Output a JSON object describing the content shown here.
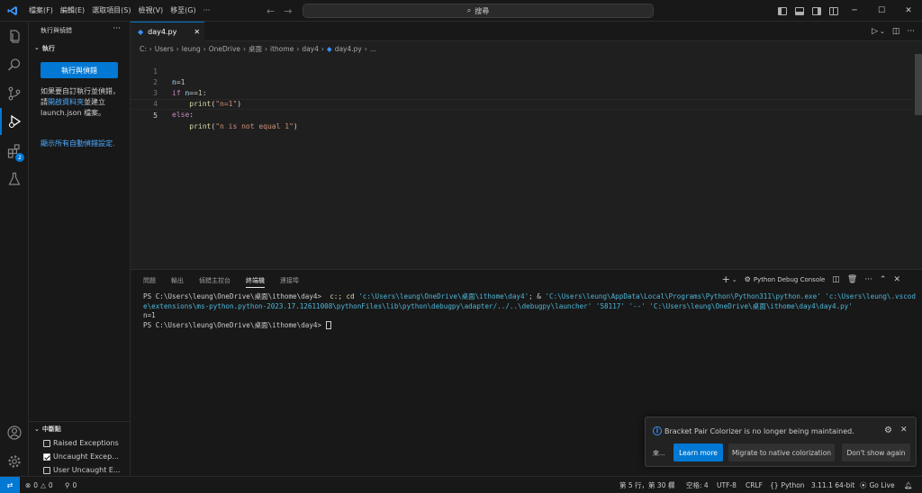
{
  "menu": [
    "檔案(F)",
    "編輯(E)",
    "選取項目(S)",
    "檢視(V)",
    "移至(G)",
    "···"
  ],
  "search": {
    "placeholder": "搜尋"
  },
  "sidebar": {
    "title": "執行與偵錯",
    "section": "執行",
    "run_button": "執行與偵錯",
    "desc_1": "如果要自訂執行並偵錯，請",
    "desc_link": "開啟資料夾",
    "desc_2": "並建立 launch.json 檔案。",
    "show_all_link": "顯示所有自動偵錯設定.",
    "breakpoints_header": "中斷點",
    "breakpoints": [
      {
        "label": "Raised Exceptions",
        "checked": false
      },
      {
        "label": "Uncaught Excep...",
        "checked": true
      },
      {
        "label": "User Uncaught E...",
        "checked": false
      }
    ]
  },
  "extensions_badge": "2",
  "editor": {
    "tab_label": "day4.py",
    "breadcrumb": [
      "C:",
      "Users",
      "leung",
      "OneDrive",
      "桌面",
      "ithome",
      "day4",
      "day4.py",
      "..."
    ],
    "lines": [
      {
        "num": "1",
        "code": "n=1"
      },
      {
        "num": "2",
        "code": "if n==1:"
      },
      {
        "num": "3",
        "code": "    print(\"n=1\")"
      },
      {
        "num": "4",
        "code": "else:"
      },
      {
        "num": "5",
        "code": "    print(\"n is not equal 1\")"
      }
    ]
  },
  "panel": {
    "tabs": [
      "問題",
      "輸出",
      "偵錯主控台",
      "終端機",
      "連接埠"
    ],
    "active_tab": "終端機",
    "terminal_profile": "Python Debug Console",
    "terminal": {
      "prompt1": "PS C:\\Users\\leung\\OneDrive\\桌面\\ithome\\day4>",
      "cmd1": "c:; cd",
      "str1": "'c:\\Users\\leung\\OneDrive\\桌面\\ithome\\day4'",
      "amp": "; &",
      "str2": "'C:\\Users\\leung\\AppData\\Local\\Programs\\Python\\Python311\\python.exe' 'c:\\Users\\leung\\.vscode\\extensions\\ms-python.python-2023.17.12611008\\pythonFiles\\lib\\python\\debugpy\\adapter/../..\\debugpy\\launcher' '58117' '--' 'C:\\Users\\leung\\OneDrive\\桌面\\ithome\\day4\\day4.py'",
      "output": "n=1",
      "prompt2": "PS C:\\Users\\leung\\OneDrive\\桌面\\ithome\\day4>"
    }
  },
  "notification": {
    "message": "Bracket Pair Colorizer is no longer being maintained.",
    "source": "來...",
    "learn_more": "Learn more",
    "migrate": "Migrate to native colorization",
    "dont_show": "Don't show again"
  },
  "status": {
    "errors": "0",
    "warnings": "0",
    "ports": "0",
    "position": "第 5 行，第 30 欄",
    "spaces": "空格: 4",
    "encoding": "UTF-8",
    "eol": "CRLF",
    "language": "Python",
    "interpreter": "3.11.1 64-bit",
    "go_live": "Go Live"
  },
  "colors": {
    "accent": "#0078d4",
    "background": "#1f1f1f",
    "panel": "#181818"
  }
}
